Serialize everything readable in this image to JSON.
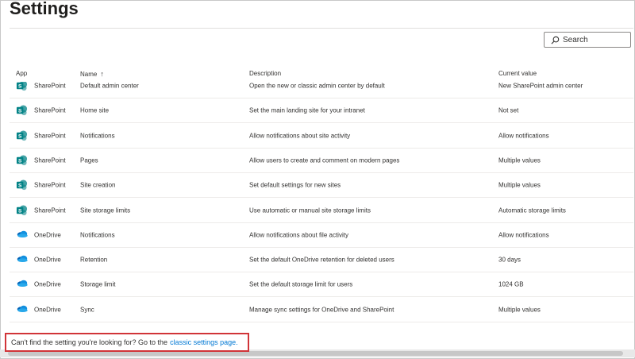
{
  "page": {
    "title": "Settings"
  },
  "search": {
    "label": "Search"
  },
  "table": {
    "columns": {
      "app": "App",
      "name": "Name",
      "description": "Description",
      "current_value": "Current value"
    },
    "rows": [
      {
        "app": "SharePoint",
        "name": "Default admin center",
        "description": "Open the new or classic admin center by default",
        "value": "New SharePoint admin center",
        "icon": "sharepoint-icon"
      },
      {
        "app": "SharePoint",
        "name": "Home site",
        "description": "Set the main landing site for your intranet",
        "value": "Not set",
        "icon": "sharepoint-icon"
      },
      {
        "app": "SharePoint",
        "name": "Notifications",
        "description": "Allow notifications about site activity",
        "value": "Allow notifications",
        "icon": "sharepoint-icon"
      },
      {
        "app": "SharePoint",
        "name": "Pages",
        "description": "Allow users to create and comment on modern pages",
        "value": "Multiple values",
        "icon": "sharepoint-icon"
      },
      {
        "app": "SharePoint",
        "name": "Site creation",
        "description": "Set default settings for new sites",
        "value": "Multiple values",
        "icon": "sharepoint-icon"
      },
      {
        "app": "SharePoint",
        "name": "Site storage limits",
        "description": "Use automatic or manual site storage limits",
        "value": "Automatic storage limits",
        "icon": "sharepoint-icon"
      },
      {
        "app": "OneDrive",
        "name": "Notifications",
        "description": "Allow notifications about file activity",
        "value": "Allow notifications",
        "icon": "onedrive-icon"
      },
      {
        "app": "OneDrive",
        "name": "Retention",
        "description": "Set the default OneDrive retention for deleted users",
        "value": "30 days",
        "icon": "onedrive-icon"
      },
      {
        "app": "OneDrive",
        "name": "Storage limit",
        "description": "Set the default storage limit for users",
        "value": "1024 GB",
        "icon": "onedrive-icon"
      },
      {
        "app": "OneDrive",
        "name": "Sync",
        "description": "Manage sync settings for OneDrive and SharePoint",
        "value": "Multiple values",
        "icon": "onedrive-icon"
      }
    ]
  },
  "footer": {
    "text": "Can't find the setting you're looking for? Go to the",
    "link": "classic settings page."
  },
  "colors": {
    "callout_border": "#d13438",
    "link": "#0078d4",
    "sharepoint": "#038387",
    "onedrive": "#0364b8"
  }
}
